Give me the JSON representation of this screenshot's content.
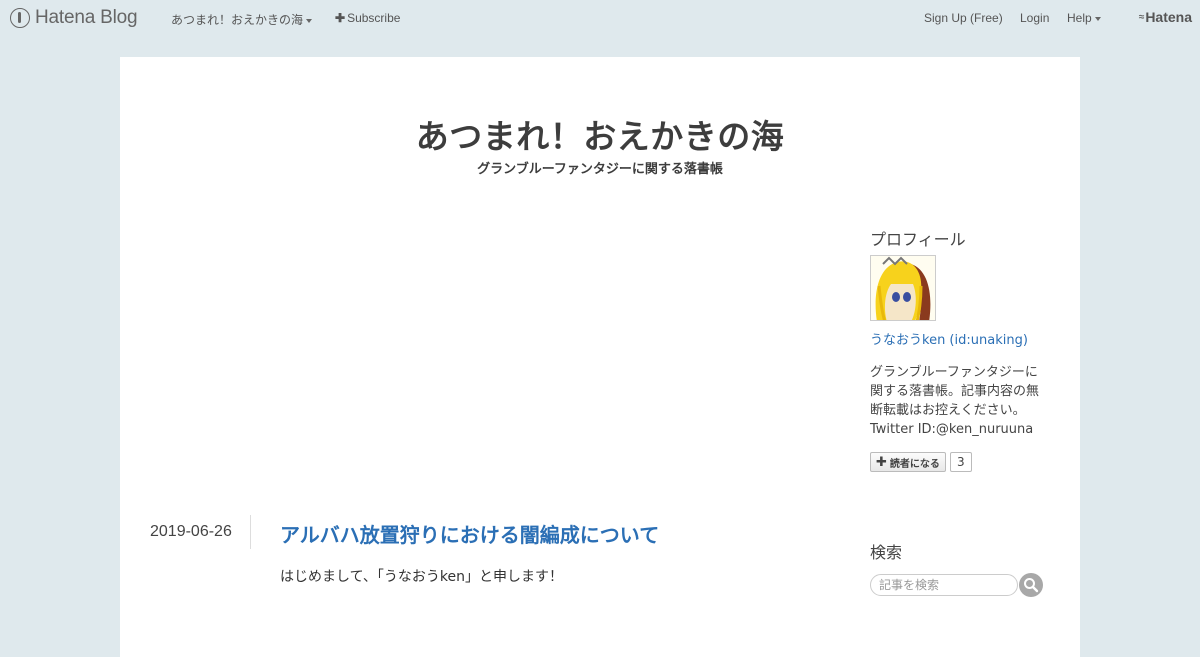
{
  "globalbar": {
    "brand": "Hatena Blog",
    "blog_menu": "あつまれ！おえかきの海",
    "subscribe": "Subscribe",
    "signup": "Sign Up (Free)",
    "login": "Login",
    "help": "Help",
    "hatena": "Hatena"
  },
  "blog": {
    "title": "あつまれ！おえかきの海",
    "description": "グランブルーファンタジーに関する落書帳"
  },
  "entry": {
    "date": "2019-06-26",
    "title": "アルバハ放置狩りにおける闇編成について",
    "intro": "はじめまして、「うなおうken」と申します！"
  },
  "sidebar": {
    "profile": {
      "heading": "プロフィール",
      "name": "うなおうken (id:unaking)",
      "description": "グランブルーファンタジーに関する落書帳。記事内容の無断転載はお控えください。",
      "twitter": "Twitter ID:@ken_nuruuna",
      "subscribe_label": "読者になる",
      "subscriber_count": "3"
    },
    "search": {
      "heading": "検索",
      "placeholder": "記事を検索"
    }
  },
  "icons": {
    "brand_logo": "hatena-blog-logo-icon",
    "plus": "plus-icon",
    "caret": "caret-down-icon",
    "search": "search-icon"
  },
  "colors": {
    "background": "#dfe9ed",
    "link": "#2b6fb5",
    "text": "#333333"
  }
}
